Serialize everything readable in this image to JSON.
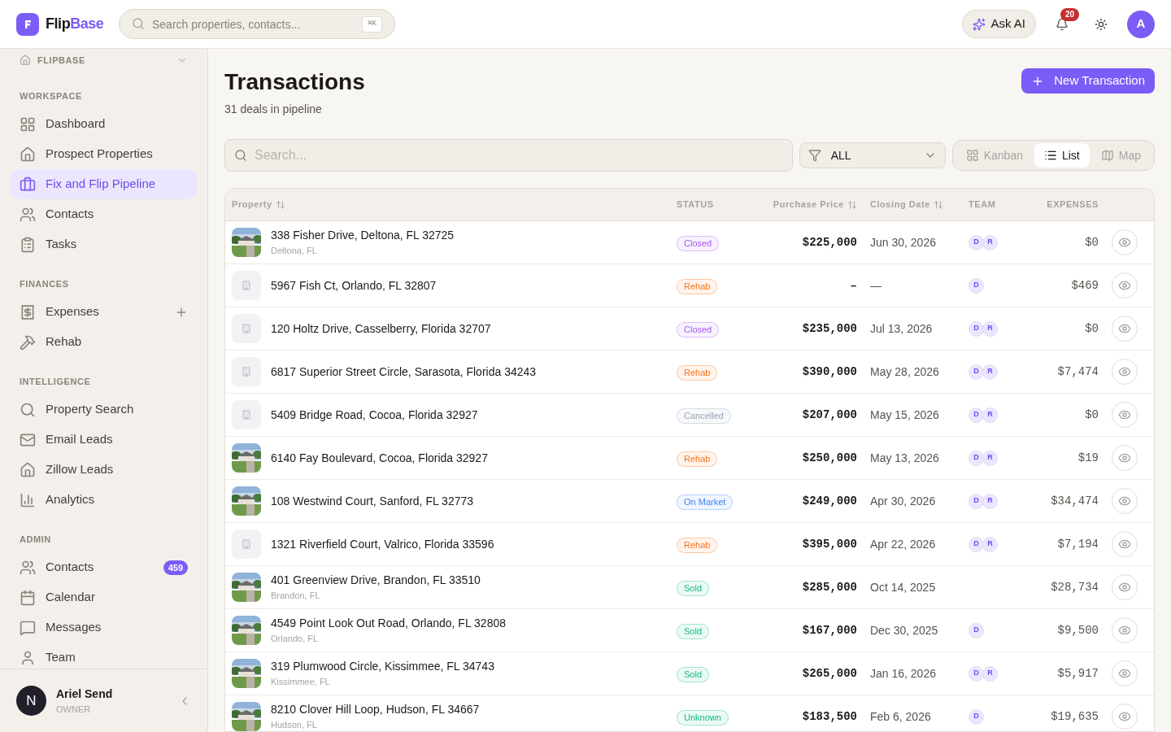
{
  "header": {
    "brand": {
      "first": "Flip",
      "second": "Base"
    },
    "search": {
      "placeholder": "Search properties, contacts...",
      "shortcut": "⌘K"
    },
    "ask_ai": "Ask AI",
    "notifications": "20",
    "avatar": "A"
  },
  "sidebar": {
    "workspace": "FLIPBASE",
    "sections": [
      {
        "title": "WORKSPACE",
        "items": [
          {
            "label": "Dashboard",
            "selected": false
          },
          {
            "label": "Prospect Properties",
            "selected": false
          },
          {
            "label": "Fix and Flip Pipeline",
            "selected": true
          },
          {
            "label": "Contacts",
            "selected": false
          },
          {
            "label": "Tasks",
            "selected": false
          }
        ]
      },
      {
        "title": "FINANCES",
        "items": [
          {
            "label": "Expenses",
            "selected": false,
            "add_button": true
          },
          {
            "label": "Rehab",
            "selected": false
          }
        ]
      },
      {
        "title": "INTELLIGENCE",
        "items": [
          {
            "label": "Property Search",
            "selected": false
          },
          {
            "label": "Email Leads",
            "selected": false
          },
          {
            "label": "Zillow Leads",
            "selected": false
          },
          {
            "label": "Analytics",
            "selected": false
          }
        ]
      },
      {
        "title": "ADMIN",
        "items": [
          {
            "label": "Contacts",
            "selected": false,
            "badge": "459"
          },
          {
            "label": "Calendar",
            "selected": false
          },
          {
            "label": "Messages",
            "selected": false
          },
          {
            "label": "Team",
            "selected": false
          }
        ]
      }
    ],
    "user": {
      "initial": "N",
      "name": "Ariel Send",
      "role": "OWNER"
    }
  },
  "page": {
    "title": "Transactions",
    "subtitle": "31 deals in pipeline",
    "new_button": "New Transaction",
    "search": {
      "placeholder": "Search..."
    },
    "filter": "ALL",
    "views": [
      {
        "label": "Kanban",
        "selected": false
      },
      {
        "label": "List",
        "selected": true
      },
      {
        "label": "Map",
        "selected": false
      }
    ]
  },
  "table": {
    "columns": [
      {
        "label": "Property",
        "sortable": true
      },
      {
        "label": "STATUS",
        "sortable": false
      },
      {
        "label": "Purchase Price",
        "sortable": true
      },
      {
        "label": "Closing Date",
        "sortable": true
      },
      {
        "label": "TEAM",
        "sortable": false
      },
      {
        "label": "EXPENSES",
        "sortable": false
      }
    ],
    "rows": [
      {
        "thumb": {
          "kind": "picture"
        },
        "address": "338 Fisher Drive, Deltona, FL 32725",
        "city": "Deltona, FL",
        "status": "Closed",
        "color": "#a855f7",
        "price": "$225,000",
        "date": "Jun 30, 2026",
        "team": [
          "D",
          "R"
        ],
        "expenses": "$0"
      },
      {
        "thumb": {
          "kind": "placeholder"
        },
        "address": "5967 Fish Ct, Orlando, FL 32807",
        "status": "Rehab",
        "color": "#f97316",
        "price": "–",
        "date": "—",
        "team": [
          "D"
        ],
        "expenses": "$469"
      },
      {
        "thumb": {
          "kind": "placeholder"
        },
        "address": "120 Holtz Drive, Casselberry, Florida 32707",
        "status": "Closed",
        "color": "#a855f7",
        "price": "$235,000",
        "date": "Jul 13, 2026",
        "team": [
          "D",
          "R"
        ],
        "expenses": "$0"
      },
      {
        "thumb": {
          "kind": "placeholder"
        },
        "address": "6817 Superior Street Circle, Sarasota, Florida 34243",
        "status": "Rehab",
        "color": "#f97316",
        "price": "$390,000",
        "date": "May 28, 2026",
        "team": [
          "D",
          "R"
        ],
        "expenses": "$7,474"
      },
      {
        "thumb": {
          "kind": "placeholder"
        },
        "address": "5409 Bridge Road, Cocoa, Florida 32927",
        "status": "Cancelled",
        "color": "#94a3b8",
        "price": "$207,000",
        "date": "May 15, 2026",
        "team": [
          "D",
          "R"
        ],
        "expenses": "$0"
      },
      {
        "thumb": {
          "kind": "picture"
        },
        "address": "6140 Fay Boulevard, Cocoa, Florida 32927",
        "status": "Rehab",
        "color": "#f97316",
        "price": "$250,000",
        "date": "May 13, 2026",
        "team": [
          "D",
          "R"
        ],
        "expenses": "$19"
      },
      {
        "thumb": {
          "kind": "picture"
        },
        "address": "108 Westwind Court, Sanford, FL 32773",
        "status": "On Market",
        "color": "#3b82f6",
        "price": "$249,000",
        "date": "Apr 30, 2026",
        "team": [
          "D",
          "R"
        ],
        "expenses": "$34,474"
      },
      {
        "thumb": {
          "kind": "placeholder"
        },
        "address": "1321 Riverfield Court, Valrico, Florida 33596",
        "status": "Rehab",
        "color": "#f97316",
        "price": "$395,000",
        "date": "Apr 22, 2026",
        "team": [
          "D",
          "R"
        ],
        "expenses": "$7,194"
      },
      {
        "thumb": {
          "kind": "picture"
        },
        "address": "401 Greenview Drive, Brandon, FL 33510",
        "city": "Brandon, FL",
        "status": "Sold",
        "color": "#10b981",
        "price": "$285,000",
        "date": "Oct 14, 2025",
        "team": [],
        "expenses": "$28,734"
      },
      {
        "thumb": {
          "kind": "picture"
        },
        "address": "4549 Point Look Out Road, Orlando, FL 32808",
        "city": "Orlando, FL",
        "status": "Sold",
        "color": "#10b981",
        "price": "$167,000",
        "date": "Dec 30, 2025",
        "team": [
          "D"
        ],
        "expenses": "$9,500"
      },
      {
        "thumb": {
          "kind": "picture"
        },
        "address": "319 Plumwood Circle, Kissimmee, FL 34743",
        "city": "Kissimmee, FL",
        "status": "Sold",
        "color": "#10b981",
        "price": "$265,000",
        "date": "Jan 16, 2026",
        "team": [
          "D",
          "R"
        ],
        "expenses": "$5,917"
      },
      {
        "thumb": {
          "kind": "picture"
        },
        "address": "8210 Clover Hill Loop, Hudson, FL 34667",
        "city": "Hudson, FL",
        "status": "Unknown",
        "color": "#10b981",
        "price": "$183,500",
        "date": "Feb 6, 2026",
        "team": [
          "D"
        ],
        "expenses": "$19,635"
      }
    ]
  }
}
